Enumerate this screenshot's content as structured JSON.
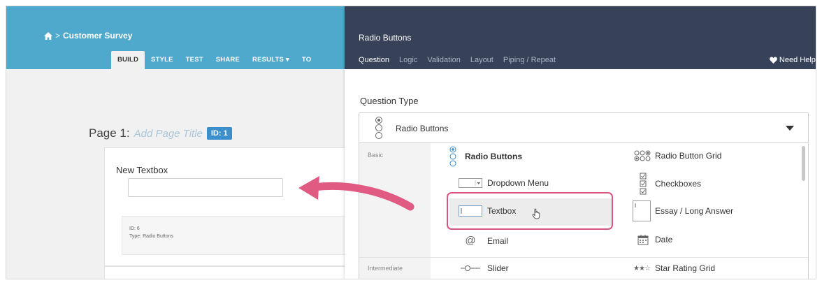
{
  "builder": {
    "breadcrumb": {
      "icon": "home-icon",
      "separator": ">",
      "title": "Customer Survey"
    },
    "tabs": [
      "BUILD",
      "STYLE",
      "TEST",
      "SHARE",
      "RESULTS ▾",
      "TO"
    ],
    "page": {
      "label": "Page 1:",
      "placeholder": "Add Page Title",
      "id_badge": "ID: 1"
    },
    "question": {
      "label": "New Textbox",
      "id_line": "ID: 6",
      "type_line": "Type: Radio Buttons"
    }
  },
  "panel": {
    "title": "Radio Buttons",
    "tabs": [
      "Question",
      "Logic",
      "Validation",
      "Layout",
      "Piping / Repeat"
    ],
    "help": "Need Help?",
    "question_type_label": "Question Type",
    "selected_type": "Radio Buttons",
    "categories": {
      "basic": "Basic",
      "intermediate": "Intermediate"
    },
    "options": {
      "radio_buttons": "Radio Buttons",
      "radio_button_grid": "Radio Button Grid",
      "dropdown_menu": "Dropdown Menu",
      "checkboxes": "Checkboxes",
      "textbox": "Textbox",
      "essay": "Essay / Long Answer",
      "email": "Email",
      "date": "Date",
      "slider": "Slider",
      "star_rating_grid": "Star Rating Grid"
    }
  },
  "colors": {
    "builder_header": "#4fa9cc",
    "panel_header": "#374259",
    "highlight": "#d9557e",
    "id_badge": "#3b8fcc"
  }
}
